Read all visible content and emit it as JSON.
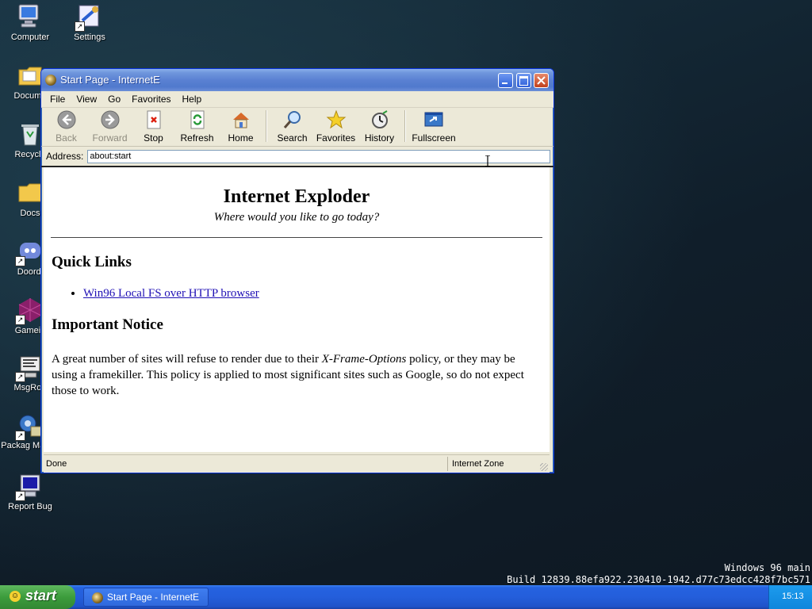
{
  "desktop": {
    "icons": [
      {
        "label": "Computer"
      },
      {
        "label": "Settings"
      },
      {
        "label": "Docume"
      },
      {
        "label": "Recycle"
      },
      {
        "label": "Docs"
      },
      {
        "label": "Doordi"
      },
      {
        "label": "Gamein"
      },
      {
        "label": "MsgRoo"
      },
      {
        "label": "Packag Manag"
      },
      {
        "label": "Report Bug"
      }
    ]
  },
  "window": {
    "title": "Start Page - InternetE",
    "menu": [
      "File",
      "View",
      "Go",
      "Favorites",
      "Help"
    ],
    "toolbar": {
      "back": "Back",
      "forward": "Forward",
      "stop": "Stop",
      "refresh": "Refresh",
      "home": "Home",
      "search": "Search",
      "favorites": "Favorites",
      "history": "History",
      "fullscreen": "Fullscreen"
    },
    "address": {
      "label": "Address:",
      "value": "about:start"
    },
    "page": {
      "heading": "Internet Exploder",
      "subheading": "Where would you like to go today?",
      "quick_links_title": "Quick Links",
      "quick_links": [
        "Win96 Local FS over HTTP browser"
      ],
      "notice_title": "Important Notice",
      "notice_text_1": "A great number of sites will refuse to render due to their ",
      "notice_em": "X-Frame-Options",
      "notice_text_2": " policy, or they may be using a framekiller. This policy is applied to most significant sites such as Google, so do not expect those to work."
    },
    "status": {
      "left": "Done",
      "zone": "Internet Zone"
    }
  },
  "taskbar": {
    "start_label": "start",
    "task_label": "Start Page - InternetE",
    "clock": "15:13"
  },
  "build_info": {
    "line1": "Windows 96 main",
    "line2": "Build 12839.88efa922.230410-1942.d77c73edcc428f7bc571"
  },
  "colors": {
    "link": "#2011b5",
    "titlebar": "#5a81d2",
    "taskbar": "#245edb",
    "start": "#3c9c3c"
  }
}
